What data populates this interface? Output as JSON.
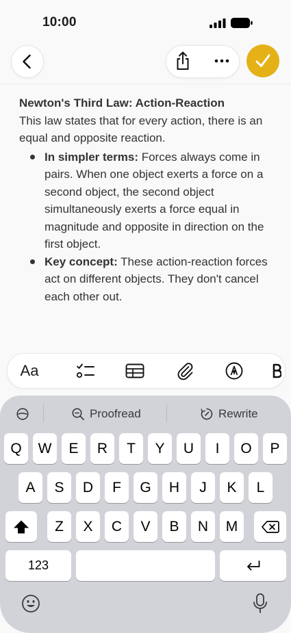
{
  "status_bar": {
    "time": "10:00"
  },
  "nav": {
    "back_icon": "chevron-left-icon",
    "share_icon": "share-icon",
    "more_icon": "ellipsis-icon",
    "done_icon": "checkmark-icon",
    "accent_color": "#e4b117"
  },
  "note": {
    "title": "Newton's Third Law: Action-Reaction",
    "intro": "This law states that for every action, there is an equal and opposite reaction.",
    "bullets": [
      {
        "label": "In simpler terms:",
        "text": " Forces always come in pairs. When one object exerts a force on a second object, the second object simultaneously exerts a force equal in magnitude and opposite in direction on the first object."
      },
      {
        "label": "Key concept:",
        "text": " These action-reaction forces act on different objects. They don't cancel each other out."
      }
    ]
  },
  "format_bar": {
    "text_style_label": "Aa",
    "icons": [
      "checklist-icon",
      "table-icon",
      "paperclip-icon",
      "markup-pen-icon",
      "bold-text-icon"
    ]
  },
  "keyboard": {
    "suggestions": {
      "proofread": "Proofread",
      "rewrite": "Rewrite"
    },
    "row1": [
      "Q",
      "W",
      "E",
      "R",
      "T",
      "Y",
      "U",
      "I",
      "O",
      "P"
    ],
    "row2": [
      "A",
      "S",
      "D",
      "F",
      "G",
      "H",
      "J",
      "K",
      "L"
    ],
    "row3": [
      "Z",
      "X",
      "C",
      "V",
      "B",
      "N",
      "M"
    ],
    "numbers_label": "123"
  }
}
